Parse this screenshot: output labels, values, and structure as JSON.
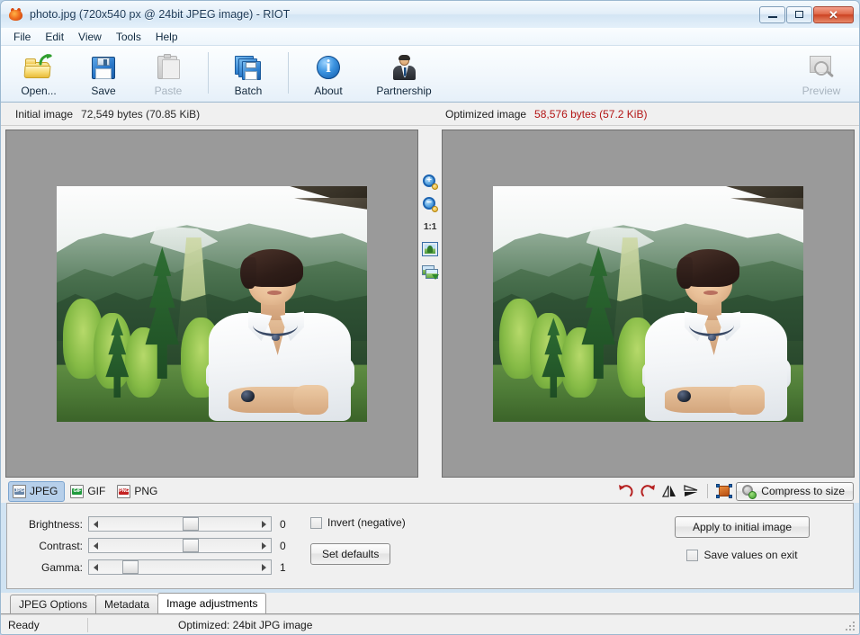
{
  "window": {
    "title": "photo.jpg (720x540 px @ 24bit JPEG image) - RIOT",
    "app_icon": "riot-app-icon",
    "minimize": "–",
    "maximize": "□",
    "close": "✕"
  },
  "menu": {
    "items": [
      "File",
      "Edit",
      "View",
      "Tools",
      "Help"
    ]
  },
  "toolbar": {
    "buttons": [
      {
        "label": "Open...",
        "icon": "open-folder-icon",
        "disabled": false
      },
      {
        "label": "Save",
        "icon": "save-floppy-icon",
        "disabled": false
      },
      {
        "label": "Paste",
        "icon": "paste-icon",
        "disabled": true
      },
      {
        "label": "Batch",
        "icon": "batch-icon",
        "disabled": false
      },
      {
        "label": "About",
        "icon": "about-info-icon",
        "disabled": false
      },
      {
        "label": "Partnership",
        "icon": "partnership-person-icon",
        "disabled": false
      }
    ],
    "preview": {
      "label": "Preview",
      "icon": "preview-magnifier-icon",
      "disabled": true
    }
  },
  "info": {
    "initial_label": "Initial image",
    "initial_value": "72,549 bytes (70.85 KiB)",
    "optimized_label": "Optimized image",
    "optimized_value": "58,576 bytes (57.2 KiB)",
    "optimized_color": "#b31515"
  },
  "zoom_column": {
    "zoom_in": "zoom-in-icon",
    "zoom_out": "zoom-out-icon",
    "ratio_label": "1:1",
    "fit_window": "fit-to-window-icon",
    "duplicate": "copy-image-icon"
  },
  "format_tabs": [
    {
      "label": "JPEG",
      "icon": "jpg-file-icon",
      "badge": "JPG",
      "active": true
    },
    {
      "label": "GIF",
      "icon": "gif-file-icon",
      "badge": "GIF",
      "active": false
    },
    {
      "label": "PNG",
      "icon": "png-file-icon",
      "badge": "PNG",
      "active": false
    }
  ],
  "image_tools": {
    "rotate_left": "rotate-left-icon",
    "rotate_right": "rotate-right-icon",
    "flip_horizontal": "flip-horizontal-icon",
    "flip_vertical": "flip-vertical-icon",
    "resize": "resize-image-icon",
    "compress_label": "Compress to size",
    "compress_icon": "gear-compress-icon"
  },
  "adjustments": {
    "sliders": [
      {
        "label": "Brightness:",
        "value": "0",
        "thumb_percent": 52
      },
      {
        "label": "Contrast:",
        "value": "0",
        "thumb_percent": 52
      },
      {
        "label": "Gamma:",
        "value": "1",
        "thumb_percent": 13
      }
    ],
    "invert_label": "Invert (negative)",
    "invert_checked": false,
    "set_defaults_label": "Set defaults",
    "apply_label": "Apply to initial image",
    "save_values_label": "Save values on exit",
    "save_values_checked": false
  },
  "bottom_tabs": [
    {
      "label": "JPEG Options",
      "active": false
    },
    {
      "label": "Metadata",
      "active": false
    },
    {
      "label": "Image adjustments",
      "active": true
    }
  ],
  "status": {
    "left": "Ready",
    "right": "Optimized: 24bit JPG image"
  }
}
